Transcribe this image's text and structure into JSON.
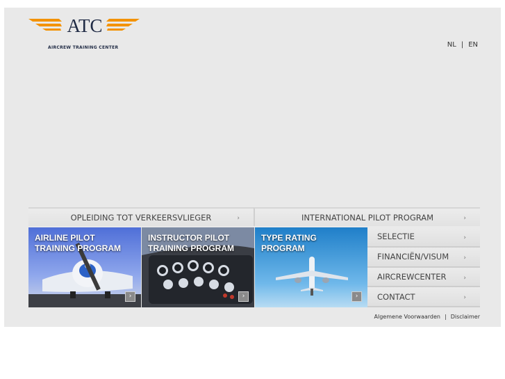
{
  "brand": {
    "logo_text": "ATC",
    "tagline": "AIRCREW TRAINING CENTER",
    "accent_color": "#f39200",
    "text_color": "#1f2a44"
  },
  "lang": {
    "nl": "NL",
    "separator": "|",
    "en": "EN"
  },
  "menu": [
    {
      "label": "OPLEIDING TOT VERKEERSVLIEGER",
      "arrow": "›"
    },
    {
      "label": "INTERNATIONAL PILOT PROGRAM",
      "arrow": "›"
    }
  ],
  "tiles": [
    {
      "title": "AIRLINE PILOT\nTRAINING PROGRAM",
      "go": "›"
    },
    {
      "title": "INSTRUCTOR PILOT\nTRAINING PROGRAM",
      "go": "›"
    },
    {
      "title": "TYPE RATING\nPROGRAM",
      "go": "›"
    }
  ],
  "side_menu": [
    {
      "label": "SELECTIE",
      "arrow": "›"
    },
    {
      "label": "FINANCIËN/VISUM",
      "arrow": "›"
    },
    {
      "label": "AIRCREWCENTER",
      "arrow": "›"
    },
    {
      "label": "CONTACT",
      "arrow": "›"
    }
  ],
  "footer": {
    "terms": "Algemene Voorwaarden",
    "separator": "|",
    "disclaimer": "Disclaimer"
  }
}
